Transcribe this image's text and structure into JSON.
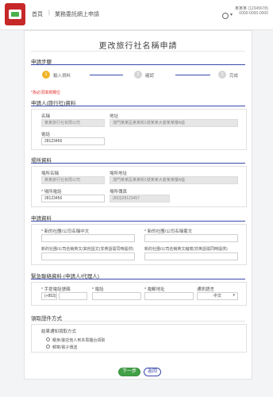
{
  "header": {
    "home_link": "首頁",
    "separator": "|",
    "apply_link": "業務委託網上申請",
    "user_name": "某某某 (12345678)",
    "user_id": "0000-0000-0000"
  },
  "page": {
    "title": "更改旅行社名稱申請"
  },
  "steps": {
    "section_title": "申請步驟",
    "items": [
      {
        "num": "1",
        "label": "輸入資料"
      },
      {
        "num": "2",
        "label": "確認"
      },
      {
        "num": "3",
        "label": "完成"
      }
    ]
  },
  "required_note": "*為必須填寫欄位",
  "applicant": {
    "section_title": "申請人(旅行社)資料",
    "name_label": "名稱",
    "name_value": "某某旅行社有限公司",
    "address_label": "地址",
    "address_value": "澳門某某區某某街1號某某大廈某某樓A座",
    "phone_label": "電話",
    "phone_value": "28123456"
  },
  "business": {
    "section_title": "場所資料",
    "name_label": "場所名稱",
    "name_value": "某某旅行社有限公司",
    "address_label": "場所地址",
    "address_value": "澳門某某區某某街1號某某大廈某某樓A座",
    "phone_label": "* 場所電話",
    "phone_value": "28123456",
    "fax_label": "場所傳真",
    "fax_value": "(853)28123457"
  },
  "application": {
    "section_title": "申請資料",
    "new_cn_label": "* 新的社團/公司名稱中文",
    "new_pt_label": "* 新的社團/公司名稱葡文",
    "new_en_label": "新的社團/公司名稱英文/其他語文(非英語需同時提供)",
    "new_other_label": "新的社團/公司名稱英文縮寫(非英語需同時提供)",
    "new_cn_value": "",
    "new_pt_value": "",
    "new_en_value": "",
    "new_other_value": ""
  },
  "contact": {
    "section_title": "緊急聯絡資料 (申請人/代理人)",
    "area_label": "* 手提電話號碼",
    "area_value": "(+853)",
    "mobile_label": "* 電話",
    "mobile_value": "",
    "email_label": "* 電郵地址",
    "email_value": "",
    "lang_label": "通訊語言",
    "lang_value": "中文"
  },
  "delivery": {
    "section_title": "領取證件方式",
    "method_label": "結果通知領取方式",
    "option1": "親身/委託他人到本局櫃台領取",
    "option2": "郵寄/電子傳送"
  },
  "actions": {
    "next_label": "下一步",
    "back_label": "返回"
  }
}
